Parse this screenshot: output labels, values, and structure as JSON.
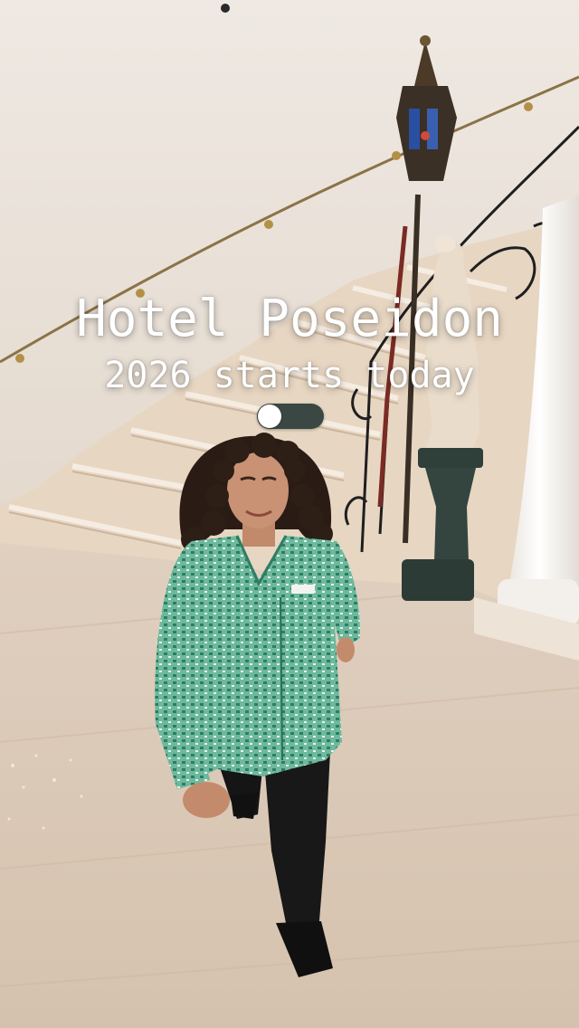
{
  "overlay": {
    "title": "Hotel Poseidon",
    "subtitle": "2026 starts today"
  },
  "toggle": {
    "state": "off"
  },
  "colors": {
    "text": "#ffffff",
    "toggle_track": "#3b4742",
    "toggle_knob": "#ffffff",
    "shirt": "#5fae93",
    "wall": "#ece6df",
    "floor": "#d8c6b4"
  },
  "icons": {
    "toggle": "toggle-switch-icon"
  }
}
